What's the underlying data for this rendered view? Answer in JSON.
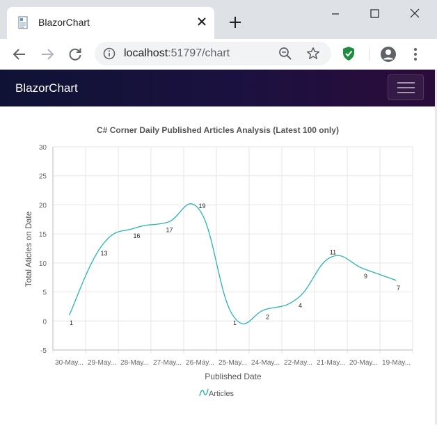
{
  "browser": {
    "tab_title": "BlazorChart",
    "url_host": "localhost",
    "url_rest": ":51797/chart",
    "icons": {
      "favicon": "document-icon",
      "close": "close-icon",
      "new_tab": "plus-icon",
      "minimize": "minimize-icon",
      "maximize": "maximize-icon",
      "window_close": "window-close-icon",
      "back": "arrow-left-icon",
      "forward": "arrow-right-icon",
      "reload": "reload-icon",
      "site_info": "info-icon",
      "zoom": "zoom-out-icon",
      "bookmark": "star-icon",
      "extension": "shield-icon",
      "profile": "account-circle-icon",
      "menu": "three-dots-vertical-icon"
    }
  },
  "app": {
    "brand": "BlazorChart",
    "nav_toggle_icon": "hamburger-icon",
    "colors": {
      "navbar_left": "#0f1235",
      "navbar_right": "#2b0b3a"
    }
  },
  "chart_data": {
    "type": "line",
    "title": "C# Corner Daily Published Articles Analysis (Latest 100 only)",
    "xlabel": "Published Date",
    "ylabel": "Total Aticles on Date",
    "categories": [
      "30-May...",
      "29-May...",
      "28-May...",
      "27-May...",
      "26-May...",
      "25-May...",
      "24-May...",
      "22-May...",
      "21-May...",
      "20-May...",
      "19-May..."
    ],
    "series": [
      {
        "name": "Articles",
        "values": [
          1,
          13,
          16,
          17,
          19,
          1,
          2,
          4,
          11,
          9,
          7
        ],
        "color": "#26b5b0"
      }
    ],
    "ylim": [
      -5,
      30
    ],
    "yticks": [
      -5,
      0,
      5,
      10,
      15,
      20,
      25,
      30
    ],
    "grid": true,
    "smooth": true,
    "data_labels": true,
    "legend_position": "bottom"
  }
}
